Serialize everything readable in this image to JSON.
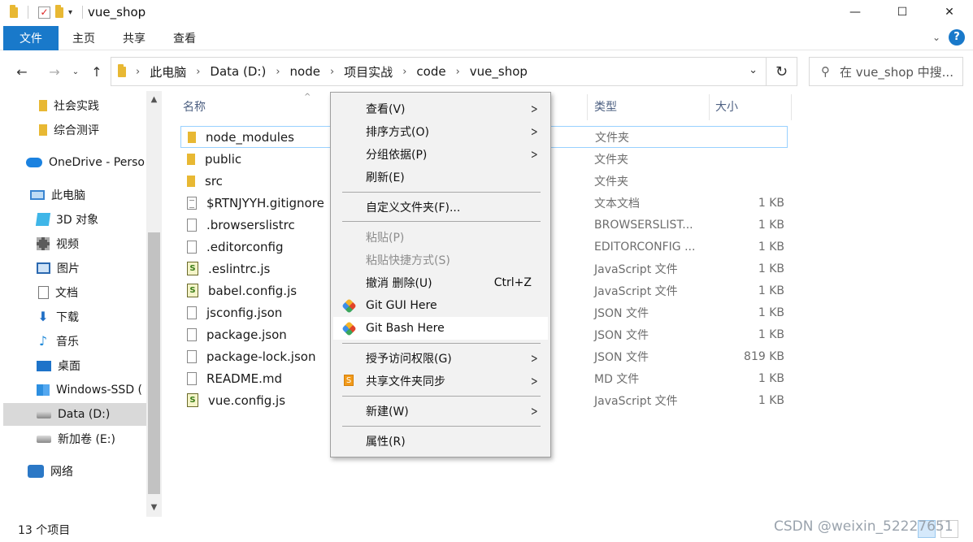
{
  "window": {
    "title": "vue_shop",
    "minimize": "—",
    "maximize": "☐",
    "close": "✕"
  },
  "ribbon": {
    "tabs": [
      "文件",
      "主页",
      "共享",
      "查看"
    ],
    "expand_icon": "chevron-down-icon",
    "help_label": "?"
  },
  "address": {
    "breadcrumbs": [
      "此电脑",
      "Data (D:)",
      "node",
      "项目实战",
      "code",
      "vue_shop"
    ],
    "search_placeholder": "在 vue_shop 中搜..."
  },
  "nav_pane": {
    "items": [
      {
        "label": "社会实践",
        "icon": "folder-icon"
      },
      {
        "label": "综合测评",
        "icon": "folder-icon"
      },
      {
        "label": "OneDrive - Perso",
        "icon": "onedrive-icon"
      },
      {
        "label": "此电脑",
        "icon": "pc-icon"
      },
      {
        "label": "3D 对象",
        "icon": "3d-objects-icon"
      },
      {
        "label": "视频",
        "icon": "video-icon"
      },
      {
        "label": "图片",
        "icon": "pictures-icon"
      },
      {
        "label": "文档",
        "icon": "documents-icon"
      },
      {
        "label": "下载",
        "icon": "downloads-icon"
      },
      {
        "label": "音乐",
        "icon": "music-icon"
      },
      {
        "label": "桌面",
        "icon": "desktop-icon"
      },
      {
        "label": "Windows-SSD (",
        "icon": "windows-drive-icon"
      },
      {
        "label": "Data (D:)",
        "icon": "drive-icon"
      },
      {
        "label": "新加卷 (E:)",
        "icon": "drive-icon"
      },
      {
        "label": "网络",
        "icon": "network-icon"
      }
    ]
  },
  "file_list": {
    "columns": {
      "name": "名称",
      "type": "类型",
      "size": "大小"
    },
    "rows": [
      {
        "name": "node_modules",
        "type": "文件夹",
        "size": "",
        "icon": "folder"
      },
      {
        "name": "public",
        "type": "文件夹",
        "size": "",
        "icon": "folder"
      },
      {
        "name": "src",
        "type": "文件夹",
        "size": "",
        "icon": "folder"
      },
      {
        "name": "$RTNJYYH.gitignore",
        "type": "文本文档",
        "size": "1 KB",
        "icon": "text"
      },
      {
        "name": ".browserslistrc",
        "type": "BROWSERSLIST...",
        "size": "1 KB",
        "icon": "blank"
      },
      {
        "name": ".editorconfig",
        "type": "EDITORCONFIG ...",
        "size": "1 KB",
        "icon": "blank"
      },
      {
        "name": ".eslintrc.js",
        "type": "JavaScript 文件",
        "size": "1 KB",
        "icon": "js"
      },
      {
        "name": "babel.config.js",
        "type": "JavaScript 文件",
        "size": "1 KB",
        "icon": "js"
      },
      {
        "name": "jsconfig.json",
        "type": "JSON 文件",
        "size": "1 KB",
        "icon": "blank"
      },
      {
        "name": "package.json",
        "type": "JSON 文件",
        "size": "1 KB",
        "icon": "blank"
      },
      {
        "name": "package-lock.json",
        "type": "JSON 文件",
        "size": "819 KB",
        "icon": "blank"
      },
      {
        "name": "README.md",
        "type": "MD 文件",
        "size": "1 KB",
        "icon": "blank"
      },
      {
        "name": "vue.config.js",
        "type": "JavaScript 文件",
        "size": "1 KB",
        "icon": "js"
      }
    ]
  },
  "status": {
    "item_count": "13 个项目",
    "watermark": "CSDN @weixin_52227651"
  },
  "context_menu": {
    "items": [
      {
        "label": "查看(V)",
        "submenu": true
      },
      {
        "label": "排序方式(O)",
        "submenu": true
      },
      {
        "label": "分组依据(P)",
        "submenu": true
      },
      {
        "label": "刷新(E)"
      },
      {
        "separator": true
      },
      {
        "label": "自定义文件夹(F)..."
      },
      {
        "separator": true
      },
      {
        "label": "粘贴(P)",
        "disabled": true
      },
      {
        "label": "粘贴快捷方式(S)",
        "disabled": true
      },
      {
        "label": "撤消 删除(U)",
        "shortcut": "Ctrl+Z"
      },
      {
        "label": "Git GUI Here",
        "icon": "git-icon"
      },
      {
        "label": "Git Bash Here",
        "icon": "git-icon",
        "highlighted": true
      },
      {
        "separator": true
      },
      {
        "label": "授予访问权限(G)",
        "submenu": true
      },
      {
        "label": "共享文件夹同步",
        "submenu": true,
        "icon": "share-sync-icon"
      },
      {
        "separator": true
      },
      {
        "label": "新建(W)",
        "submenu": true
      },
      {
        "separator": true
      },
      {
        "label": "属性(R)"
      }
    ]
  }
}
